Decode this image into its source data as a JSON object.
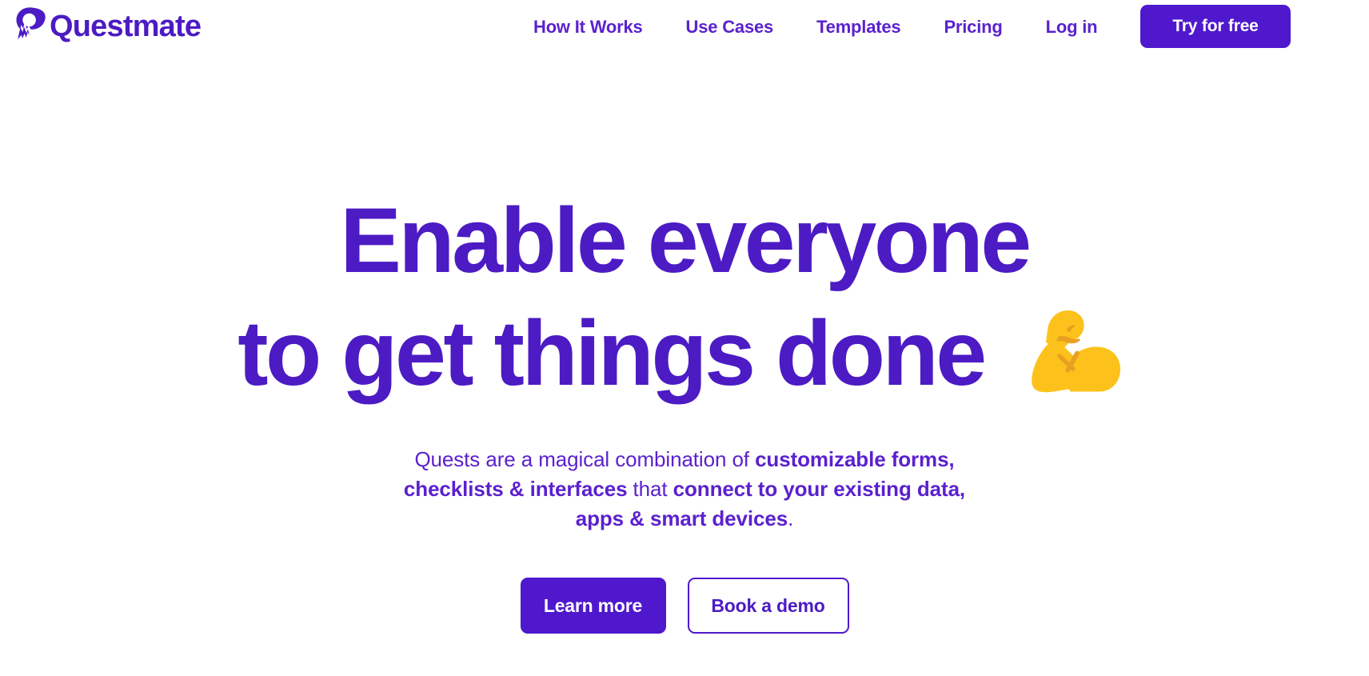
{
  "brand": {
    "name": "Questmate",
    "logo_icon": "questmate-q-flame-icon",
    "color": "#4c1bc4"
  },
  "header": {
    "nav_items": [
      {
        "label": "How It Works",
        "name": "nav-how-it-works"
      },
      {
        "label": "Use Cases",
        "name": "nav-use-cases"
      },
      {
        "label": "Templates",
        "name": "nav-templates"
      },
      {
        "label": "Pricing",
        "name": "nav-pricing"
      },
      {
        "label": "Log in",
        "name": "nav-log-in"
      }
    ],
    "cta_label": "Try for free",
    "cta_color": "#4f18cd"
  },
  "hero": {
    "title_line_1": "Enable everyone",
    "title_line_2": "to get things done",
    "title_emoji": "flexed-biceps-emoji",
    "title_color": "#4c1bc4",
    "subheading": {
      "part_1": "Quests are a magical combination of ",
      "bold_1": "customizable forms, checklists & interfaces",
      "part_2": " that ",
      "bold_2": "connect to your existing data, apps & smart devices",
      "part_3": "."
    },
    "buttons": [
      {
        "label": "Learn more",
        "name": "learn-more-button",
        "style": "primary"
      },
      {
        "label": "Book a demo",
        "name": "book-a-demo-button",
        "style": "secondary"
      }
    ]
  },
  "colors": {
    "brand_purple": "#4c1bc4",
    "button_purple": "#4f18cd",
    "nav_purple": "#5b21ce",
    "emoji_yellow": "#fcc21b",
    "emoji_yellow_dark": "#e8a020",
    "background": "#ffffff"
  }
}
